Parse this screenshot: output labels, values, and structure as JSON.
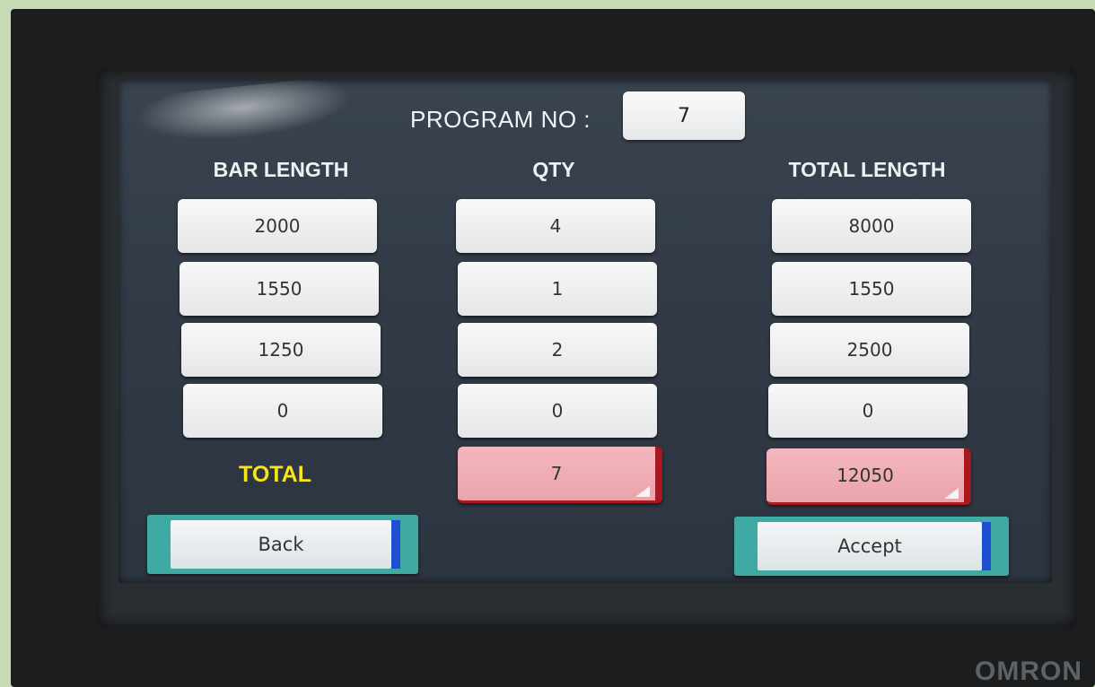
{
  "header": {
    "program_label": "PROGRAM NO  :",
    "program_value": "7"
  },
  "columns": {
    "bar_length": "BAR LENGTH",
    "qty": "QTY",
    "total_length": "TOTAL LENGTH"
  },
  "rows": [
    {
      "bar_length": "2000",
      "qty": "4",
      "total_length": "8000"
    },
    {
      "bar_length": "1550",
      "qty": "1",
      "total_length": "1550"
    },
    {
      "bar_length": "1250",
      "qty": "2",
      "total_length": "2500"
    },
    {
      "bar_length": "0",
      "qty": "0",
      "total_length": "0"
    }
  ],
  "totals": {
    "label": "TOTAL",
    "qty": "7",
    "total_length": "12050"
  },
  "buttons": {
    "back": "Back",
    "accept": "Accept"
  },
  "brand": "OMRON",
  "colors": {
    "total_label": "#f6e619",
    "total_cell_fill": "#f3b7bd",
    "total_cell_edge": "#a8191f",
    "button_frame": "#3fa9a3",
    "button_edge": "#1d4fd0"
  }
}
